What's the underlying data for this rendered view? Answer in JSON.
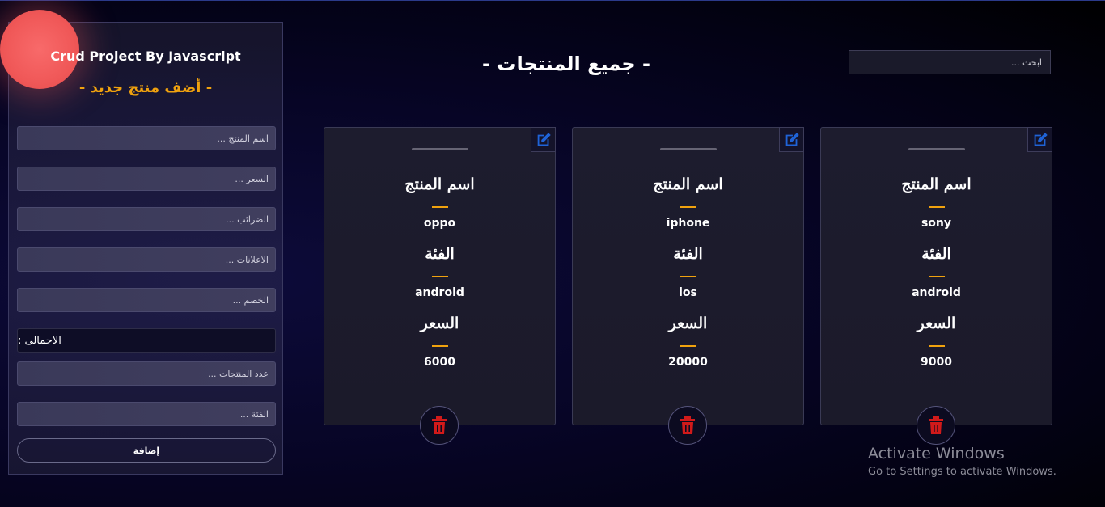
{
  "sidebar": {
    "title": "Crud Project By Javascript",
    "subtitle": "- أضف منتج جديد -",
    "fields": {
      "name": "اسم المنتج ...",
      "price": "السعر ...",
      "taxes": "الضرائب ...",
      "ads": "الاعلانات ...",
      "discount": "الخصم ...",
      "count": "عدد المنتجات ...",
      "category": "الفئة ..."
    },
    "total_label": "الاجمالى :",
    "add_button": "إضافة"
  },
  "header": {
    "title": "- جميع المنتجات -",
    "search_placeholder": "ابحث ..."
  },
  "labels": {
    "name": "اسم المنتج",
    "category": "الفئة",
    "price": "السعر"
  },
  "products": [
    {
      "name": "sony",
      "category": "android",
      "price": "9000"
    },
    {
      "name": "iphone",
      "category": "ios",
      "price": "20000"
    },
    {
      "name": "oppo",
      "category": "android",
      "price": "6000"
    }
  ],
  "watermark": {
    "line1": "Activate Windows",
    "line2": "Go to Settings to activate Windows."
  },
  "colors": {
    "accent": "#f0a20e",
    "blob": "#f05858",
    "edit_icon": "#1f63d8",
    "delete_icon": "#d11a1a"
  },
  "icons": {
    "edit": "edit-icon",
    "delete": "trash-icon"
  }
}
